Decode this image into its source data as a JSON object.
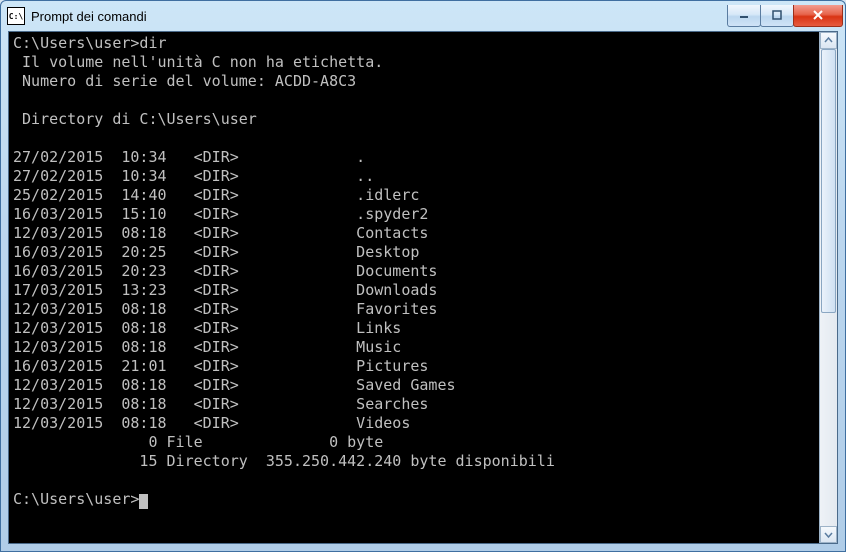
{
  "window": {
    "title": "Prompt dei comandi"
  },
  "console": {
    "prompt_path": "C:\\Users\\user>",
    "command": "dir",
    "volume_line": " Il volume nell'unità C non ha etichetta.",
    "serial_line": " Numero di serie del volume: ACDD-A8C3",
    "directory_line": " Directory di C:\\Users\\user",
    "entries": [
      {
        "date": "27/02/2015",
        "time": "10:34",
        "type": "<DIR>",
        "name": "."
      },
      {
        "date": "27/02/2015",
        "time": "10:34",
        "type": "<DIR>",
        "name": ".."
      },
      {
        "date": "25/02/2015",
        "time": "14:40",
        "type": "<DIR>",
        "name": ".idlerc"
      },
      {
        "date": "16/03/2015",
        "time": "15:10",
        "type": "<DIR>",
        "name": ".spyder2"
      },
      {
        "date": "12/03/2015",
        "time": "08:18",
        "type": "<DIR>",
        "name": "Contacts"
      },
      {
        "date": "16/03/2015",
        "time": "20:25",
        "type": "<DIR>",
        "name": "Desktop"
      },
      {
        "date": "16/03/2015",
        "time": "20:23",
        "type": "<DIR>",
        "name": "Documents"
      },
      {
        "date": "17/03/2015",
        "time": "13:23",
        "type": "<DIR>",
        "name": "Downloads"
      },
      {
        "date": "12/03/2015",
        "time": "08:18",
        "type": "<DIR>",
        "name": "Favorites"
      },
      {
        "date": "12/03/2015",
        "time": "08:18",
        "type": "<DIR>",
        "name": "Links"
      },
      {
        "date": "12/03/2015",
        "time": "08:18",
        "type": "<DIR>",
        "name": "Music"
      },
      {
        "date": "16/03/2015",
        "time": "21:01",
        "type": "<DIR>",
        "name": "Pictures"
      },
      {
        "date": "12/03/2015",
        "time": "08:18",
        "type": "<DIR>",
        "name": "Saved Games"
      },
      {
        "date": "12/03/2015",
        "time": "08:18",
        "type": "<DIR>",
        "name": "Searches"
      },
      {
        "date": "12/03/2015",
        "time": "08:18",
        "type": "<DIR>",
        "name": "Videos"
      }
    ],
    "summary_files": "               0 File              0 byte",
    "summary_dirs": "              15 Directory  355.250.442.240 byte disponibili"
  }
}
